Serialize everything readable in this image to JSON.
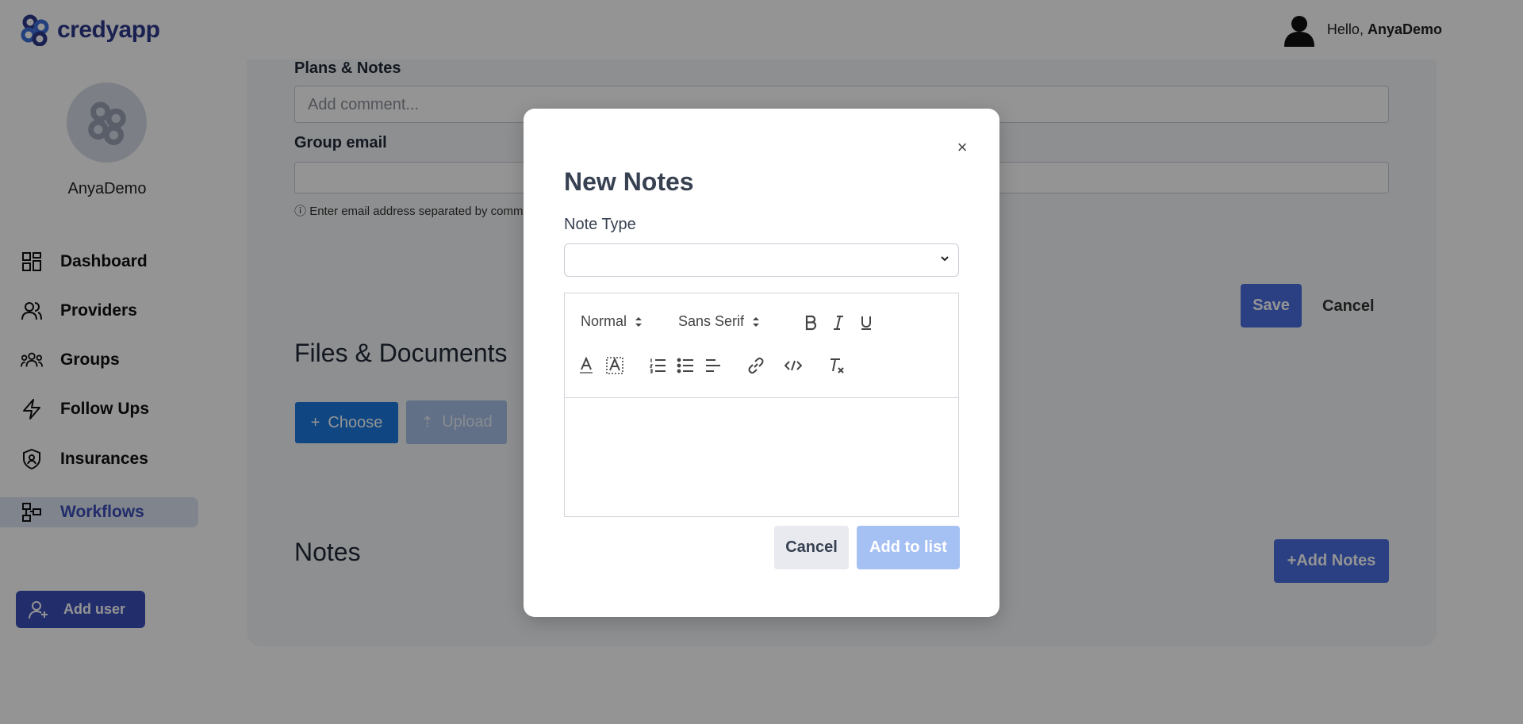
{
  "header": {
    "brand": "credyapp",
    "greeting": "Hello,",
    "username": "AnyaDemo"
  },
  "sidebar": {
    "user_name": "AnyaDemo",
    "items": [
      {
        "label": "Dashboard",
        "icon": "grid-icon"
      },
      {
        "label": "Providers",
        "icon": "user-icon"
      },
      {
        "label": "Groups",
        "icon": "users-icon"
      },
      {
        "label": "Follow Ups",
        "icon": "lightning-icon"
      },
      {
        "label": "Insurances",
        "icon": "shield-icon"
      },
      {
        "label": "Workflows",
        "icon": "workflow-icon",
        "active": true
      }
    ],
    "add_user_label": "Add user"
  },
  "main": {
    "plans_label": "Plans & Notes",
    "comment_placeholder": "Add comment...",
    "group_email_label": "Group email",
    "email_hint": "Enter email address separated by comm",
    "save_label": "Save",
    "cancel_label": "Cancel",
    "files_title": "Files & Documents",
    "choose_label": "Choose",
    "upload_label": "Upload",
    "notes_title": "Notes",
    "add_notes_label": "+Add Notes"
  },
  "modal": {
    "title": "New Notes",
    "close_glyph": "×",
    "note_type_label": "Note Type",
    "note_type_value": "",
    "toolbar": {
      "header_value": "Normal",
      "font_value": "Sans Serif"
    },
    "editor_content": "",
    "cancel_label": "Cancel",
    "add_label": "Add to list"
  },
  "colors": {
    "accent": "#3b4fb8",
    "primary_button": "#4a6ee0",
    "choose_button": "#1d7be0"
  }
}
